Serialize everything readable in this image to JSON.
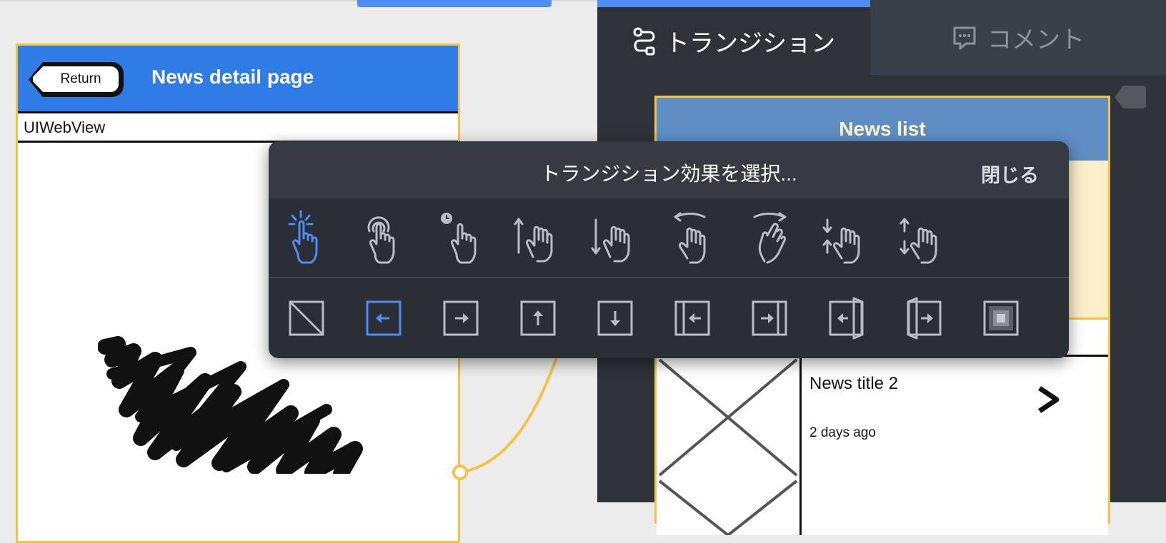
{
  "left_mockup": {
    "return_label": "Return",
    "title": "News detail page",
    "webview_label": "UIWebView"
  },
  "right_panel": {
    "tabs": [
      {
        "label": "トランジション",
        "icon": "transition-icon",
        "active": true
      },
      {
        "label": "コメント",
        "icon": "comment-icon",
        "active": false
      }
    ],
    "mockup": {
      "header_title": "News list",
      "news_item": {
        "title": "News title 2",
        "time": "2 days ago"
      }
    }
  },
  "popover": {
    "title": "トランジション効果を選択...",
    "close_label": "閉じる",
    "gestures": [
      {
        "name": "tap-gesture-icon",
        "selected": true
      },
      {
        "name": "double-tap-gesture-icon",
        "selected": false
      },
      {
        "name": "long-press-gesture-icon",
        "selected": false
      },
      {
        "name": "swipe-up-gesture-icon",
        "selected": false
      },
      {
        "name": "swipe-down-gesture-icon",
        "selected": false
      },
      {
        "name": "swipe-left-gesture-icon",
        "selected": false
      },
      {
        "name": "swipe-right-gesture-icon",
        "selected": false
      },
      {
        "name": "pinch-in-gesture-icon",
        "selected": false
      },
      {
        "name": "pinch-out-gesture-icon",
        "selected": false
      }
    ],
    "effects": [
      {
        "name": "no-transition-icon",
        "selected": false
      },
      {
        "name": "slide-left-icon",
        "selected": true
      },
      {
        "name": "slide-right-icon",
        "selected": false
      },
      {
        "name": "slide-up-icon",
        "selected": false
      },
      {
        "name": "slide-down-icon",
        "selected": false
      },
      {
        "name": "push-left-icon",
        "selected": false
      },
      {
        "name": "push-right-icon",
        "selected": false
      },
      {
        "name": "door-left-icon",
        "selected": false
      },
      {
        "name": "door-right-icon",
        "selected": false
      },
      {
        "name": "fade-icon",
        "selected": false
      }
    ]
  },
  "colors": {
    "accent": "#4f8cf3",
    "panel_bg": "#2e333a",
    "popover_bg": "#2a2e35",
    "selection_outline": "#f6c244",
    "icon_default": "#b9bdc4"
  }
}
